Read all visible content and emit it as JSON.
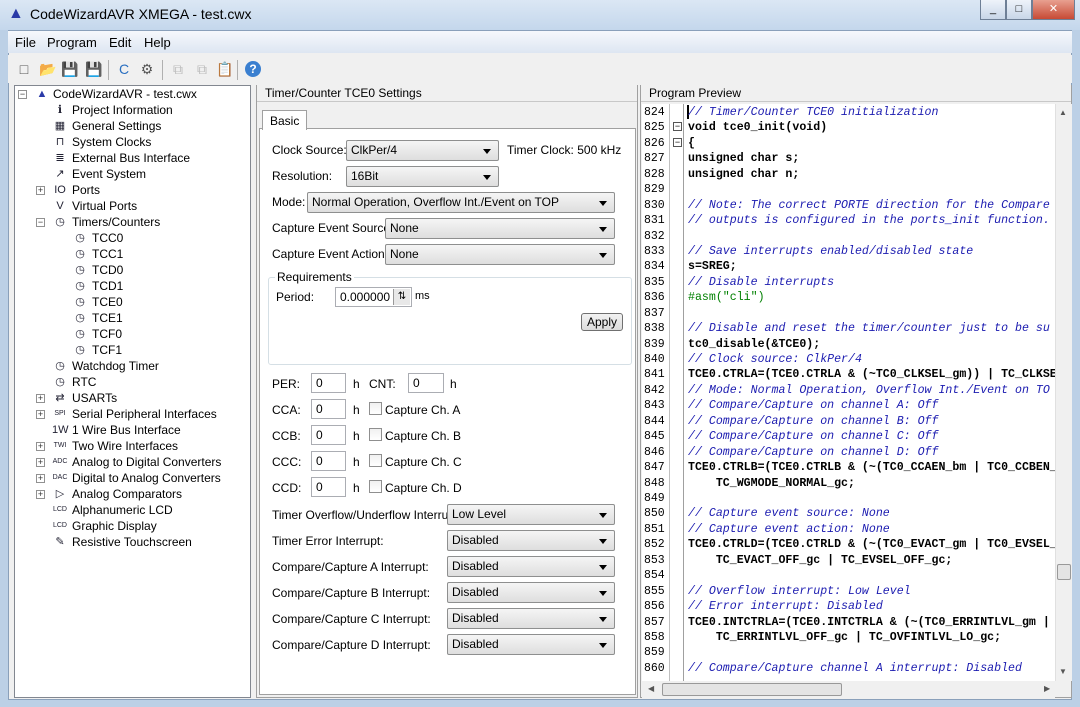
{
  "window": {
    "title": "CodeWizardAVR XMEGA - test.cwx",
    "minimize": "_",
    "maximize": "□",
    "close": "✕"
  },
  "menu": [
    {
      "label": "File"
    },
    {
      "label": "Program"
    },
    {
      "label": "Edit"
    },
    {
      "label": "Help"
    }
  ],
  "toolbar": [
    {
      "icon": "new-file-icon",
      "glyph": "□"
    },
    {
      "icon": "open-icon",
      "glyph": "📂"
    },
    {
      "icon": "save-icon",
      "glyph": "💾"
    },
    {
      "icon": "save-as-icon",
      "glyph": "💾"
    },
    {
      "icon": "generate-c-icon",
      "glyph": "C"
    },
    {
      "icon": "generate-save-icon",
      "glyph": "⚙"
    },
    {
      "icon": "copy-disabled-icon",
      "glyph": "⧉"
    },
    {
      "icon": "paste-disabled-icon",
      "glyph": "⧉"
    },
    {
      "icon": "notes-icon",
      "glyph": "📋"
    },
    {
      "icon": "help-icon",
      "glyph": "?"
    }
  ],
  "tree": {
    "items": [
      {
        "label": "CodeWizardAVR - test.cwx",
        "level": 0,
        "expander": "−",
        "icon": "wizard-icon",
        "glyph": "▲"
      },
      {
        "label": "Project Information",
        "level": 1,
        "icon": "info-icon",
        "glyph": "ℹ"
      },
      {
        "label": "General Settings",
        "level": 1,
        "icon": "settings-icon",
        "glyph": "▦"
      },
      {
        "label": "System Clocks",
        "level": 1,
        "icon": "clock-signal-icon",
        "glyph": "⊓"
      },
      {
        "label": "External Bus Interface",
        "level": 1,
        "icon": "bus-icon",
        "glyph": "≣"
      },
      {
        "label": "Event System",
        "level": 1,
        "icon": "event-icon",
        "glyph": "↗"
      },
      {
        "label": "Ports",
        "level": 1,
        "expander": "+",
        "icon": "ports-icon",
        "glyph": "IO"
      },
      {
        "label": "Virtual Ports",
        "level": 1,
        "icon": "virtual-ports-icon",
        "glyph": "V"
      },
      {
        "label": "Timers/Counters",
        "level": 1,
        "expander": "−",
        "icon": "timer-icon",
        "glyph": "◷"
      },
      {
        "label": "TCC0",
        "level": 2,
        "icon": "timer-icon",
        "glyph": "◷"
      },
      {
        "label": "TCC1",
        "level": 2,
        "icon": "timer-icon",
        "glyph": "◷"
      },
      {
        "label": "TCD0",
        "level": 2,
        "icon": "timer-icon",
        "glyph": "◷"
      },
      {
        "label": "TCD1",
        "level": 2,
        "icon": "timer-icon",
        "glyph": "◷"
      },
      {
        "label": "TCE0",
        "level": 2,
        "icon": "timer-icon",
        "glyph": "◷"
      },
      {
        "label": "TCE1",
        "level": 2,
        "icon": "timer-icon",
        "glyph": "◷"
      },
      {
        "label": "TCF0",
        "level": 2,
        "icon": "timer-icon",
        "glyph": "◷"
      },
      {
        "label": "TCF1",
        "level": 2,
        "icon": "timer-icon",
        "glyph": "◷"
      },
      {
        "label": "Watchdog Timer",
        "level": 1,
        "icon": "watchdog-icon",
        "glyph": "◷"
      },
      {
        "label": "RTC",
        "level": 1,
        "icon": "rtc-icon",
        "glyph": "◷"
      },
      {
        "label": "USARTs",
        "level": 1,
        "expander": "+",
        "icon": "usart-icon",
        "glyph": "⇄"
      },
      {
        "label": "Serial Peripheral Interfaces",
        "level": 1,
        "expander": "+",
        "icon": "spi-icon",
        "glyph": "SPI"
      },
      {
        "label": "1 Wire Bus Interface",
        "level": 1,
        "icon": "one-wire-icon",
        "glyph": "1W"
      },
      {
        "label": "Two Wire Interfaces",
        "level": 1,
        "expander": "+",
        "icon": "twi-icon",
        "glyph": "TWI"
      },
      {
        "label": "Analog to Digital Converters",
        "level": 1,
        "expander": "+",
        "icon": "adc-icon",
        "glyph": "ADC"
      },
      {
        "label": "Digital to Analog Converters",
        "level": 1,
        "expander": "+",
        "icon": "dac-icon",
        "glyph": "DAC"
      },
      {
        "label": "Analog Comparators",
        "level": 1,
        "expander": "+",
        "icon": "comparator-icon",
        "glyph": "▷"
      },
      {
        "label": "Alphanumeric LCD",
        "level": 1,
        "icon": "lcd-icon",
        "glyph": "LCD"
      },
      {
        "label": "Graphic Display",
        "level": 1,
        "icon": "graphic-lcd-icon",
        "glyph": "LCD"
      },
      {
        "label": "Resistive Touchscreen",
        "level": 1,
        "icon": "touchscreen-icon",
        "glyph": "✎"
      }
    ]
  },
  "settings": {
    "header": "Timer/Counter TCE0 Settings",
    "tab": "Basic",
    "clock_source_label": "Clock Source:",
    "clock_source": "ClkPer/4",
    "timer_clock": "Timer Clock: 500 kHz",
    "resolution_label": "Resolution:",
    "resolution": "16Bit",
    "mode_label": "Mode:",
    "mode": "Normal Operation, Overflow Int./Event on TOP",
    "ces_label": "Capture Event Source:",
    "ces": "None",
    "cea_label": "Capture Event Action:",
    "cea": "None",
    "requirements": "Requirements",
    "period_label": "Period:",
    "period": "0.000000",
    "period_unit": "ms",
    "apply": "Apply",
    "per_label": "PER:",
    "per": "0",
    "cnt_label": "CNT:",
    "cnt": "0",
    "hex": "h",
    "channels": [
      {
        "label": "CCA:",
        "value": "0",
        "capture": "Capture Ch. A"
      },
      {
        "label": "CCB:",
        "value": "0",
        "capture": "Capture Ch. B"
      },
      {
        "label": "CCC:",
        "value": "0",
        "capture": "Capture Ch. C"
      },
      {
        "label": "CCD:",
        "value": "0",
        "capture": "Capture Ch. D"
      }
    ],
    "interrupts": [
      {
        "label": "Timer Overflow/Underflow Interrupt:",
        "value": "Low Level"
      },
      {
        "label": "Timer Error Interrupt:",
        "value": "Disabled"
      },
      {
        "label": "Compare/Capture A Interrupt:",
        "value": "Disabled"
      },
      {
        "label": "Compare/Capture B Interrupt:",
        "value": "Disabled"
      },
      {
        "label": "Compare/Capture C Interrupt:",
        "value": "Disabled"
      },
      {
        "label": "Compare/Capture D Interrupt:",
        "value": "Disabled"
      }
    ]
  },
  "preview": {
    "header": "Program Preview",
    "lines": [
      {
        "n": "824",
        "t": "// Timer/Counter TCE0 initialization",
        "k": "cm"
      },
      {
        "n": "825",
        "t": "void tce0_init(void)",
        "fold": "−"
      },
      {
        "n": "826",
        "t": "{",
        "fold": "−"
      },
      {
        "n": "827",
        "t": "unsigned char s;"
      },
      {
        "n": "828",
        "t": "unsigned char n;"
      },
      {
        "n": "829",
        "t": ""
      },
      {
        "n": "830",
        "t": "// Note: The correct PORTE direction for the Compare",
        "k": "cm"
      },
      {
        "n": "831",
        "t": "// outputs is configured in the ports_init function.",
        "k": "cm"
      },
      {
        "n": "832",
        "t": ""
      },
      {
        "n": "833",
        "t": "// Save interrupts enabled/disabled state",
        "k": "cm"
      },
      {
        "n": "834",
        "t": "s=SREG;"
      },
      {
        "n": "835",
        "t": "// Disable interrupts",
        "k": "cm"
      },
      {
        "n": "836",
        "t": "#asm(\"cli\")",
        "k": "pp"
      },
      {
        "n": "837",
        "t": ""
      },
      {
        "n": "838",
        "t": "// Disable and reset the timer/counter just to be su",
        "k": "cm"
      },
      {
        "n": "839",
        "t": "tc0_disable(&TCE0);"
      },
      {
        "n": "840",
        "t": "// Clock source: ClkPer/4",
        "k": "cm"
      },
      {
        "n": "841",
        "t": "TCE0.CTRLA=(TCE0.CTRLA & (~TC0_CLKSEL_gm)) | TC_CLKSE"
      },
      {
        "n": "842",
        "t": "// Mode: Normal Operation, Overflow Int./Event on TO",
        "k": "cm"
      },
      {
        "n": "843",
        "t": "// Compare/Capture on channel A: Off",
        "k": "cm"
      },
      {
        "n": "844",
        "t": "// Compare/Capture on channel B: Off",
        "k": "cm"
      },
      {
        "n": "845",
        "t": "// Compare/Capture on channel C: Off",
        "k": "cm"
      },
      {
        "n": "846",
        "t": "// Compare/Capture on channel D: Off",
        "k": "cm"
      },
      {
        "n": "847",
        "t": "TCE0.CTRLB=(TCE0.CTRLB & (~(TC0_CCAEN_bm | TC0_CCBEN_"
      },
      {
        "n": "848",
        "t": "    TC_WGMODE_NORMAL_gc;"
      },
      {
        "n": "849",
        "t": ""
      },
      {
        "n": "850",
        "t": "// Capture event source: None",
        "k": "cm"
      },
      {
        "n": "851",
        "t": "// Capture event action: None",
        "k": "cm"
      },
      {
        "n": "852",
        "t": "TCE0.CTRLD=(TCE0.CTRLD & (~(TC0_EVACT_gm | TC0_EVSEL_"
      },
      {
        "n": "853",
        "t": "    TC_EVACT_OFF_gc | TC_EVSEL_OFF_gc;"
      },
      {
        "n": "854",
        "t": ""
      },
      {
        "n": "855",
        "t": "// Overflow interrupt: Low Level",
        "k": "cm"
      },
      {
        "n": "856",
        "t": "// Error interrupt: Disabled",
        "k": "cm"
      },
      {
        "n": "857",
        "t": "TCE0.INTCTRLA=(TCE0.INTCTRLA & (~(TC0_ERRINTLVL_gm |"
      },
      {
        "n": "858",
        "t": "    TC_ERRINTLVL_OFF_gc | TC_OVFINTLVL_LO_gc;"
      },
      {
        "n": "859",
        "t": ""
      },
      {
        "n": "860",
        "t": "// Compare/Capture channel A interrupt: Disabled",
        "k": "cm"
      }
    ]
  }
}
